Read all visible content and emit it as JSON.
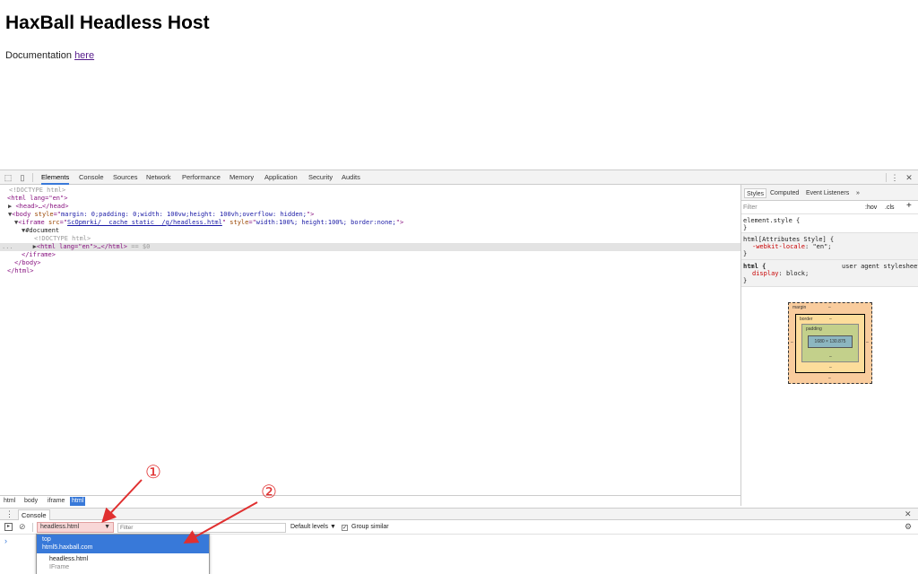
{
  "page": {
    "title": "HaxBall Headless Host",
    "doc_text": "Documentation",
    "doc_link": "here"
  },
  "devtools": {
    "tabs": [
      "Elements",
      "Console",
      "Sources",
      "Network",
      "Performance",
      "Memory",
      "Application",
      "Security",
      "Audits"
    ],
    "active_tab": "Elements",
    "toolbar_icons": [
      "inspect-element-icon",
      "device-toolbar-icon",
      "more-options-icon",
      "close-icon"
    ],
    "dom": {
      "doctype": "<!DOCTYPE html>",
      "html_open": "<html lang=\"en\">",
      "head": "<head>…</head>",
      "body_tag": "body",
      "body_style_attr": "style",
      "body_style_val": "margin: 0;padding: 0;width: 100vw;height: 100vh;overflow: hidden;",
      "iframe_tag": "iframe",
      "iframe_src_attr": "src",
      "iframe_src_val": "ScOpmrki/__cache_static__/g/headless.html",
      "iframe_style_attr": "style",
      "iframe_style_val": "width:100%; height:100%; border:none;",
      "document": "#document",
      "inner_doctype": "<!DOCTYPE html>",
      "inner_html": "<html lang=\"en\">…</html>",
      "selected_marker": "== $0",
      "gutter": "...",
      "iframe_close": "</iframe>",
      "body_close": "</body>",
      "html_close": "</html>"
    },
    "breadcrumbs": [
      "html",
      "body",
      "iframe",
      "html"
    ],
    "styles": {
      "tabs": [
        "Styles",
        "Computed",
        "Event Listeners",
        "»"
      ],
      "filter_placeholder": "Filter",
      "hov": ":hov",
      "cls": ".cls",
      "plus": "+",
      "element_style": "element.style {",
      "close_brace": "}",
      "attr_rule": "html[Attributes Style] {",
      "attr_prop": "-webkit-locale",
      "attr_val": "\"en\";",
      "html_rule": "html {",
      "ua_label": "user agent stylesheet",
      "display_prop": "display",
      "display_val": "block;"
    },
    "box_model": {
      "margin": "margin",
      "border": "border",
      "padding": "padding",
      "dash": "–",
      "content_size": "1680 × 130.875"
    }
  },
  "console": {
    "drawer_tab": "Console",
    "context": "headless.html",
    "filter_placeholder": "Filter",
    "levels": "Default levels ▼",
    "group_similar": "Group similar",
    "prompt": "›",
    "dropdown": {
      "item1_line1": "top",
      "item1_line2": "html5.haxball.com",
      "item2_line1": "headless.html",
      "item2_line2": "IFrame"
    }
  },
  "annotations": {
    "marker1": "①",
    "marker2": "②",
    "color": "#e03030"
  }
}
